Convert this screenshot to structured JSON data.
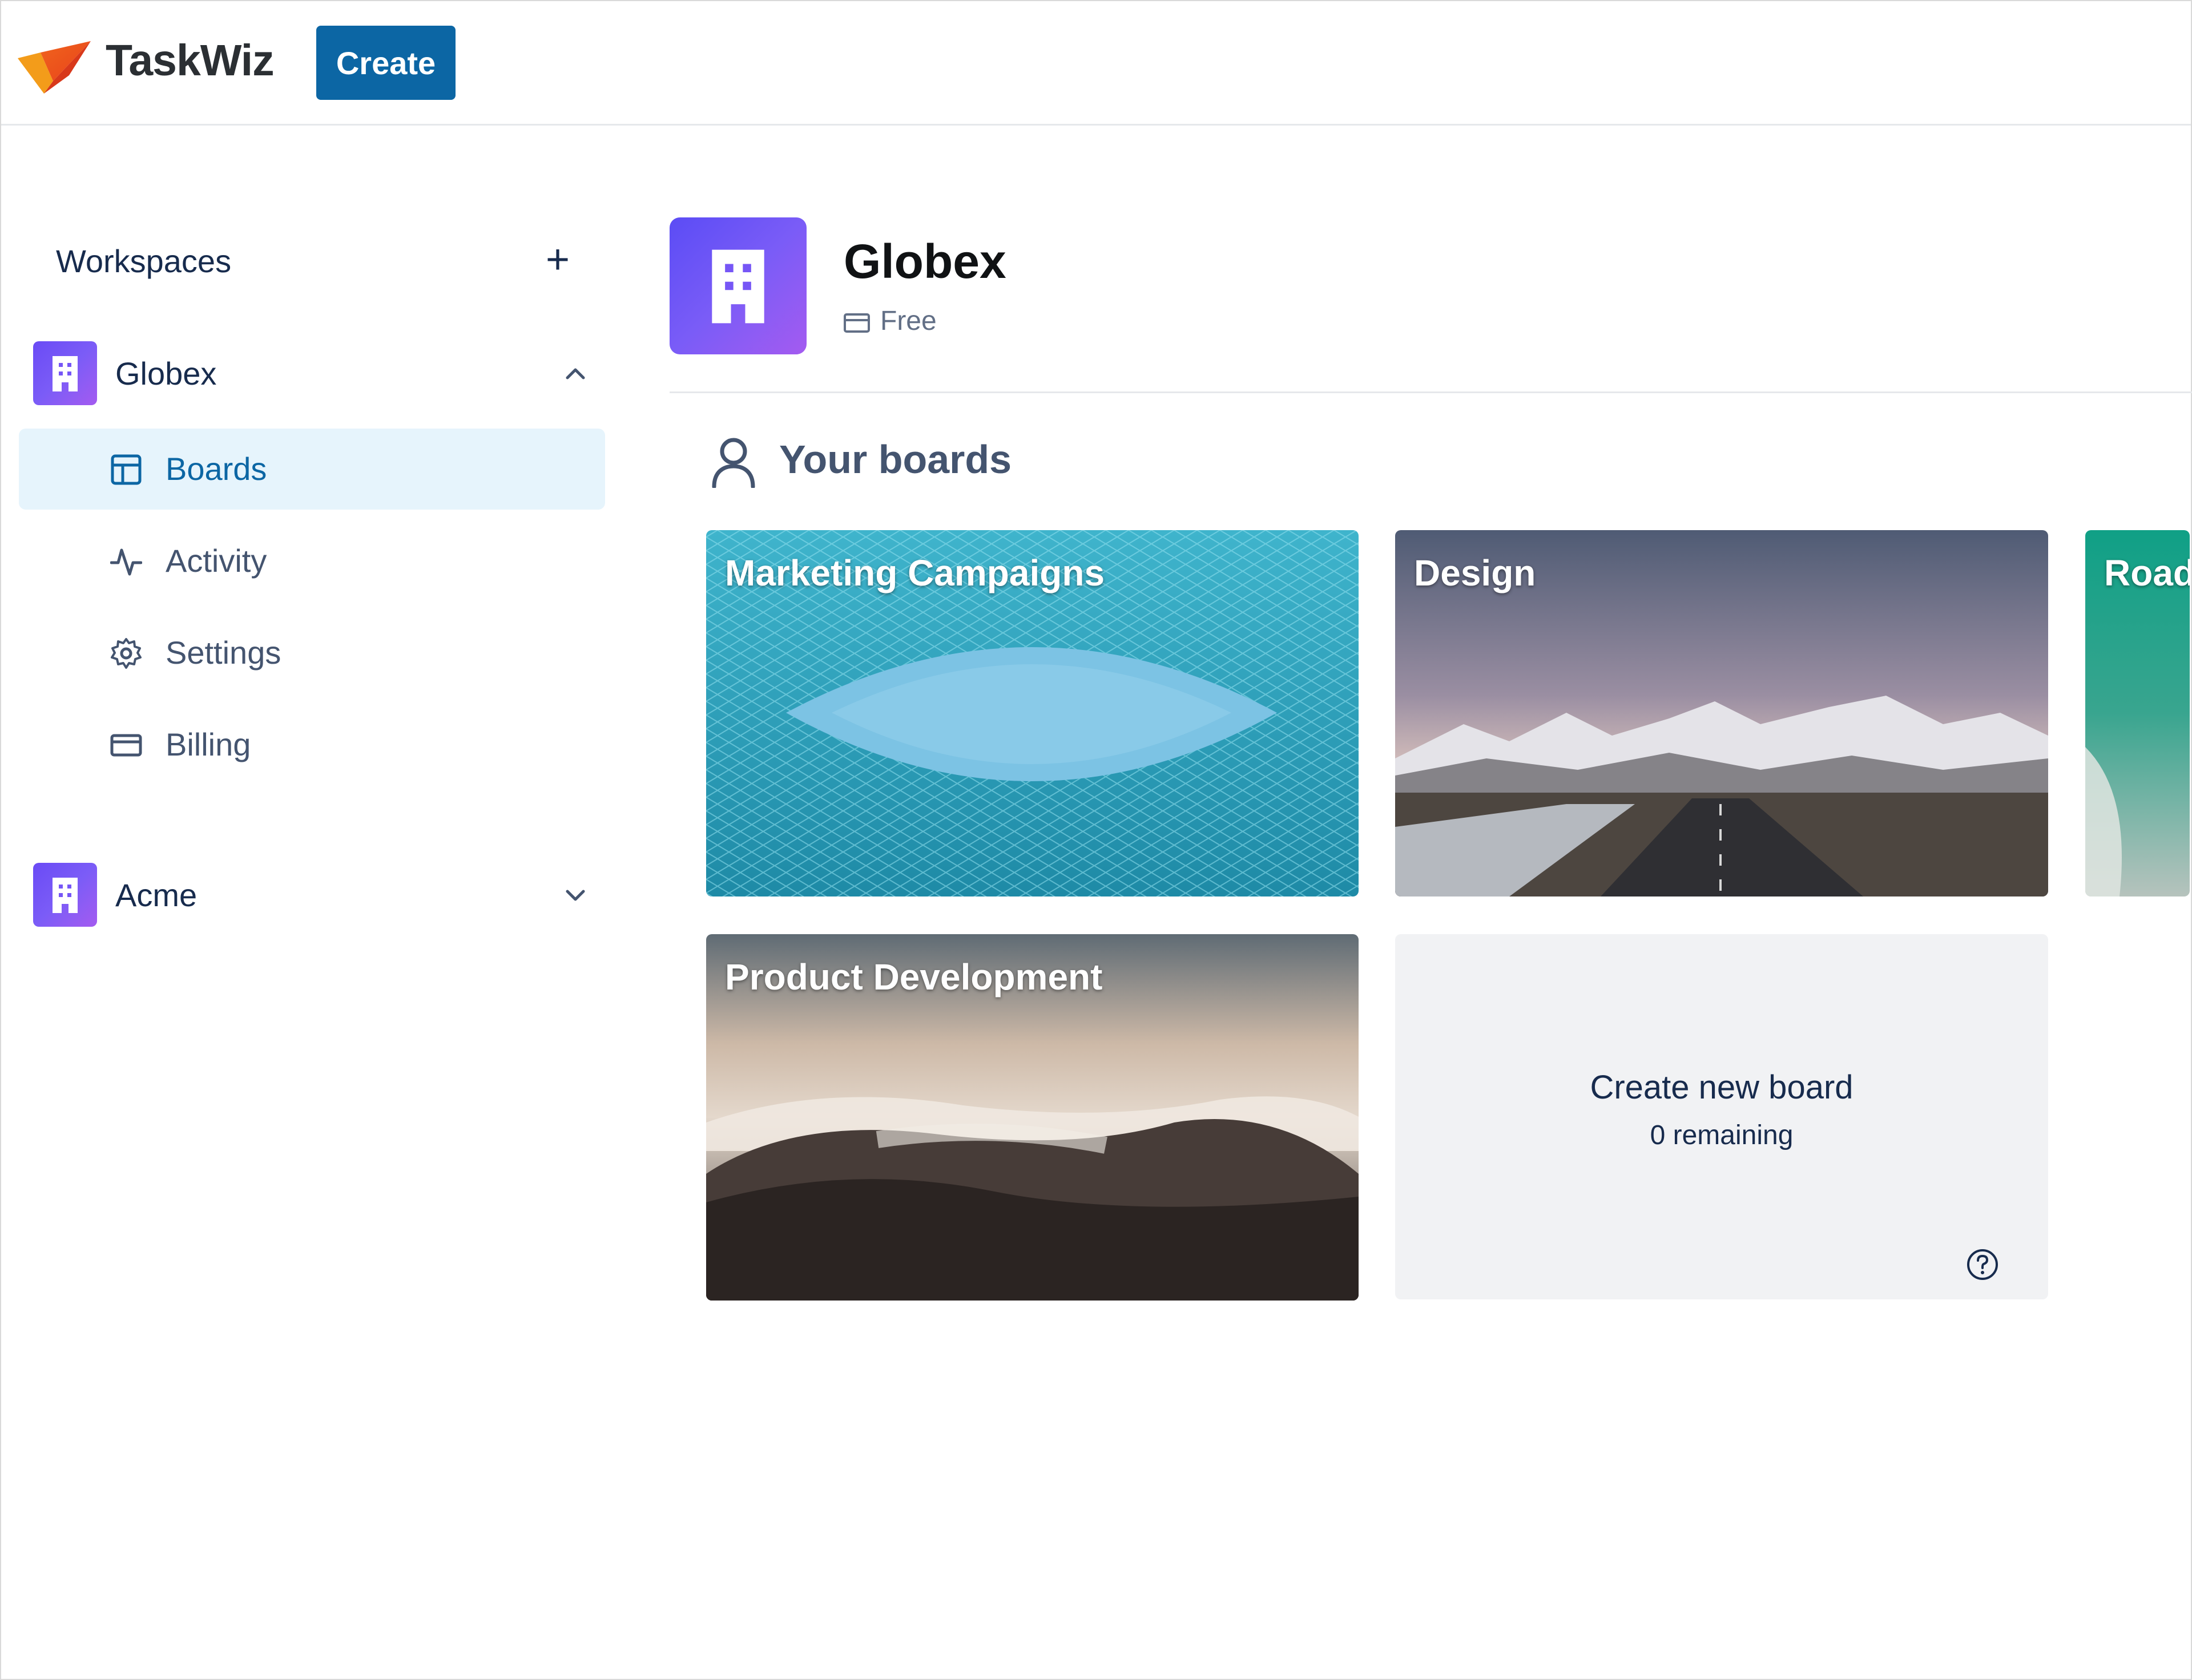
{
  "header": {
    "app_name": "TaskWiz",
    "create_label": "Create"
  },
  "sidebar": {
    "title": "Workspaces",
    "add_symbol": "+",
    "workspaces": [
      {
        "name": "Globex",
        "expanded": true,
        "items": [
          {
            "label": "Boards",
            "icon": "board-icon",
            "active": true
          },
          {
            "label": "Activity",
            "icon": "activity-icon",
            "active": false
          },
          {
            "label": "Settings",
            "icon": "gear-icon",
            "active": false
          },
          {
            "label": "Billing",
            "icon": "credit-card-icon",
            "active": false
          }
        ]
      },
      {
        "name": "Acme",
        "expanded": false
      }
    ]
  },
  "main": {
    "workspace_name": "Globex",
    "plan": "Free",
    "section_title": "Your boards",
    "boards": [
      {
        "title": "Marketing Campaigns"
      },
      {
        "title": "Design"
      },
      {
        "title": "Road"
      },
      {
        "title": "Product Development"
      }
    ],
    "new_board": {
      "label": "Create new board",
      "remaining": "0 remaining"
    }
  },
  "colors": {
    "accent": "#0c66a4",
    "active_nav_bg": "#e6f4fc",
    "avatar_gradient_start": "#6a4bf5",
    "avatar_gradient_end": "#a45bf0"
  }
}
